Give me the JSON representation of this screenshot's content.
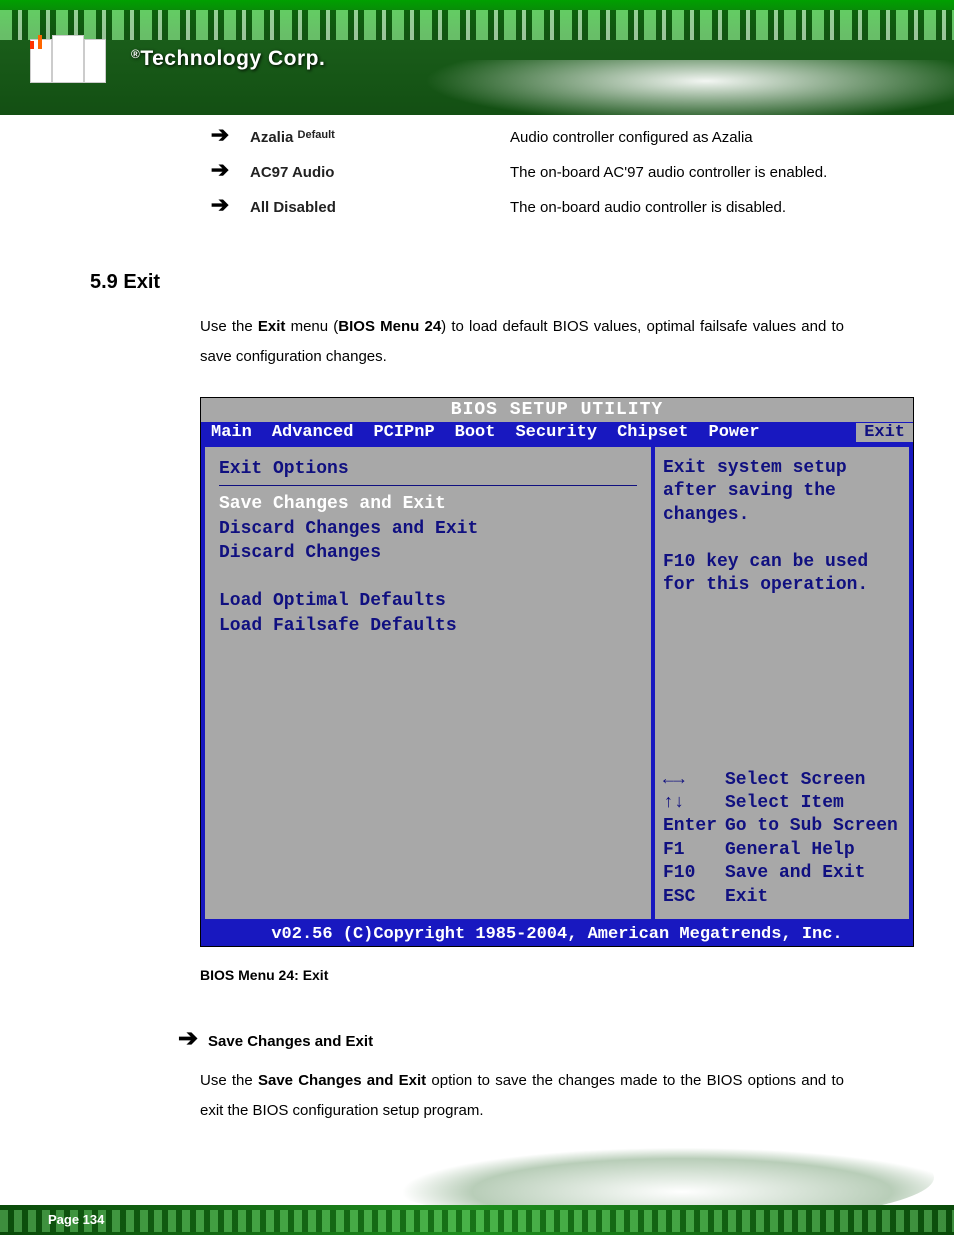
{
  "header": {
    "logo_text": "Technology Corp.",
    "reg": "®"
  },
  "options": [
    {
      "label": "Azalia",
      "default_note": "Default",
      "desc": "Audio controller configured as Azalia"
    },
    {
      "label": "AC97 Audio",
      "default_note": "",
      "desc": "The on-board AC'97 audio controller is enabled."
    },
    {
      "label": "All Disabled",
      "default_note": "",
      "desc": "The on-board audio controller is disabled."
    }
  ],
  "section": {
    "number": "5.9",
    "title": "Exit"
  },
  "intro": {
    "pre": "Use the ",
    "bold1": "Exit",
    "mid": " menu (",
    "bold2": "BIOS Menu 24",
    "post": ") to load default BIOS values, optimal failsafe values and to save configuration changes."
  },
  "bios": {
    "title": "BIOS SETUP UTILITY",
    "menu": [
      "Main",
      "Advanced",
      "PCIPnP",
      "Boot",
      "Security",
      "Chipset",
      "Power"
    ],
    "menu_active": "Exit",
    "left": {
      "heading": "Exit Options",
      "items": [
        "Save Changes and Exit",
        "Discard Changes and Exit",
        "Discard Changes",
        "",
        "Load Optimal Defaults",
        "Load Failsafe Defaults"
      ],
      "selected_index": 0
    },
    "right": {
      "help1": "Exit system setup",
      "help2": "after saving the",
      "help3": "changes.",
      "help4": "F10 key can be used",
      "help5": "for this operation.",
      "nav": [
        {
          "key": "←→",
          "label": "Select Screen"
        },
        {
          "key": "↑↓",
          "label": "Select Item"
        },
        {
          "key": "Enter",
          "label": "Go to Sub Screen"
        },
        {
          "key": "F1",
          "label": "General Help"
        },
        {
          "key": "F10",
          "label": "Save and Exit"
        },
        {
          "key": "ESC",
          "label": "Exit"
        }
      ]
    },
    "footer": "v02.56 (C)Copyright 1985-2004, American Megatrends, Inc."
  },
  "figure_caption": {
    "label": "BIOS Menu 24:",
    "text": "Exit"
  },
  "sub_option": {
    "label": "Save Changes and Exit"
  },
  "sub_para": {
    "pre": "Use the ",
    "bold": "Save Changes and Exit",
    "post": " option to save the changes made to the BIOS options and to exit the BIOS configuration setup program."
  },
  "page_number": "Page 134"
}
